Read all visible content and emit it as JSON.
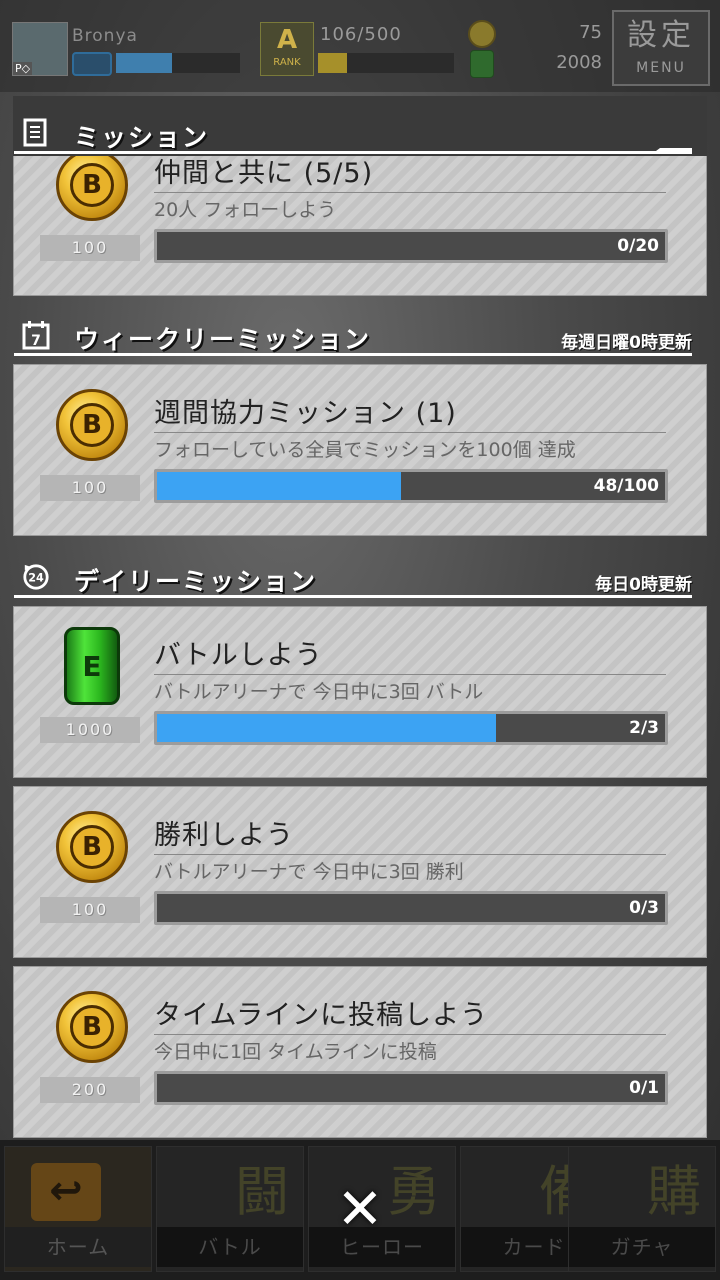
{
  "topbar": {
    "avatar_badge": "P◇",
    "user_name": "Bronya",
    "user_level_fill": 0.45,
    "rank_letter": "A",
    "rank_label": "RANK",
    "rank_progress_text": "106/500",
    "rank_fill": 0.21,
    "coins": "75",
    "cans": "2008",
    "settings_kanji": "設定",
    "settings_label": "MENU"
  },
  "sections": {
    "mission": {
      "title": "ミッション",
      "icon": "document-icon"
    },
    "weekly": {
      "title": "ウィークリーミッション",
      "note": "毎週日曜0時更新",
      "icon": "calendar-7-icon"
    },
    "daily": {
      "title": "デイリーミッション",
      "note": "毎日0時更新",
      "icon": "clock-24-icon"
    }
  },
  "missions": {
    "follow": {
      "title": "仲間と共に (5/5)",
      "desc": "20人 フォローしよう",
      "reward_type": "coin",
      "reward_amount": "100",
      "progress": "0/20",
      "fill": 0.0
    },
    "weekly_coop": {
      "title": "週間協力ミッション (1)",
      "desc": "フォローしている全員でミッションを100個 達成",
      "reward_type": "coin",
      "reward_amount": "100",
      "progress": "48/100",
      "fill": 0.48
    },
    "battle": {
      "title": "バトルしよう",
      "desc": "バトルアリーナで 今日中に3回 バトル",
      "reward_type": "can",
      "reward_amount": "1000",
      "progress": "2/3",
      "fill": 0.667
    },
    "win": {
      "title": "勝利しよう",
      "desc": "バトルアリーナで 今日中に3回 勝利",
      "reward_type": "coin",
      "reward_amount": "100",
      "progress": "0/3",
      "fill": 0.0
    },
    "timeline": {
      "title": "タイムラインに投稿しよう",
      "desc": "今日中に1回 タイムラインに投稿",
      "reward_type": "coin",
      "reward_amount": "200",
      "progress": "0/1",
      "fill": 0.0
    }
  },
  "nav": {
    "home": "ホーム",
    "battle": "バトル",
    "battle_kanji": "闘",
    "hero": "ヒーロー",
    "hero_kanji": "勇",
    "card": "カード",
    "card_kanji": "備",
    "gacha": "ガチャ",
    "gacha_kanji": "購",
    "close": "✕"
  },
  "colors": {
    "progress_fill": "#3ca3f3",
    "progress_track": "#4a4a4a",
    "card_bg": "#cfcfcf"
  }
}
